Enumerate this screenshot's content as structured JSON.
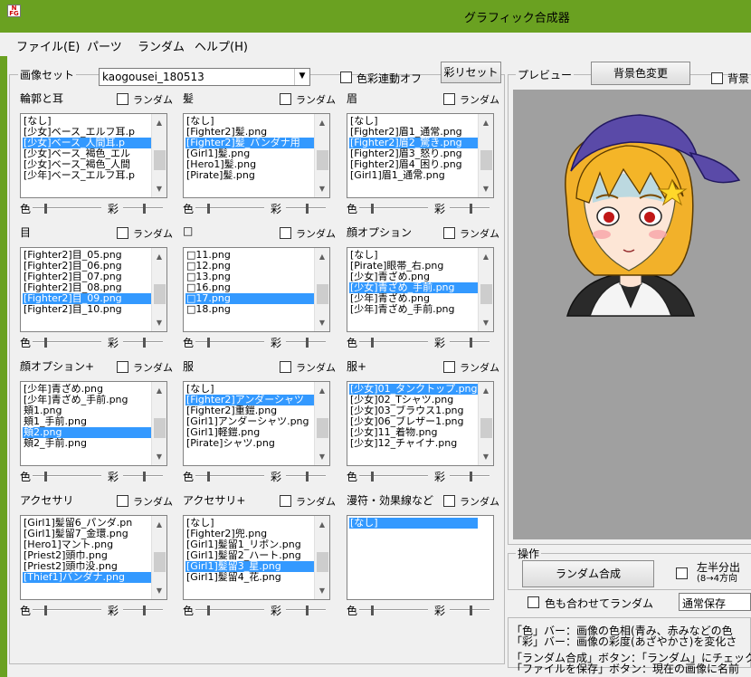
{
  "window": {
    "title": "グラフィック合成器"
  },
  "menu": [
    {
      "label": "ファイル(E)"
    },
    {
      "label": "パーツ"
    },
    {
      "label": "ランダム"
    },
    {
      "label": "ヘルプ(H)"
    }
  ],
  "image_set": {
    "label": "画像セット",
    "value": "kaogousei_180513",
    "color_link": "色彩連動オフ",
    "saturation_reset": "彩リセット"
  },
  "labels": {
    "random": "ランダム",
    "color": "色",
    "sat": "彩"
  },
  "parts": [
    {
      "title": "輪郭と耳",
      "items": [
        "[なし]",
        "[少女]ベース_エルフ耳.p",
        "[少女]ベース_人間耳.p",
        "[少女]ベース_褐色_エル",
        "[少女]ベース_褐色_人間",
        "[少年]ベース_エルフ耳.p"
      ],
      "selected": 2
    },
    {
      "title": "髪",
      "items": [
        "[なし]",
        "[Fighter2]髪.png",
        "[Fighter2]髪_バンダナ用",
        "[Girl1]髪.png",
        "[Hero1]髪.png",
        "[Pirate]髪.png"
      ],
      "selected": 2
    },
    {
      "title": "眉",
      "items": [
        "[なし]",
        "[Fighter2]眉1_通常.png",
        "[Fighter2]眉2_驚き.png",
        "[Fighter2]眉3_怒り.png",
        "[Fighter2]眉4_困り.png",
        "[Girl1]眉1_通常.png"
      ],
      "selected": 2
    },
    {
      "title": "目",
      "items": [
        "[Fighter2]目_05.png",
        "[Fighter2]目_06.png",
        "[Fighter2]目_07.png",
        "[Fighter2]目_08.png",
        "[Fighter2]目_09.png",
        "[Fighter2]目_10.png"
      ],
      "selected": 4
    },
    {
      "title": "□",
      "items": [
        "□11.png",
        "□12.png",
        "□13.png",
        "□16.png",
        "□17.png",
        "□18.png"
      ],
      "selected": 4
    },
    {
      "title": "顔オプション",
      "items": [
        "[なし]",
        "[Pirate]眼帯_右.png",
        "[少女]青ざめ.png",
        "[少女]青ざめ_手前.png",
        "[少年]青ざめ.png",
        "[少年]青ざめ_手前.png"
      ],
      "selected": 3
    },
    {
      "title": "顔オプション+",
      "items": [
        "[少年]青ざめ.png",
        "[少年]青ざめ_手前.png",
        "頬1.png",
        "頬1_手前.png",
        "頬2.png",
        "頬2_手前.png"
      ],
      "selected": 4
    },
    {
      "title": "服",
      "items": [
        "[なし]",
        "[Fighter2]アンダーシャツ",
        "[Fighter2]重鎧.png",
        "[Girl1]アンダーシャツ.png",
        "[Girl1]軽鎧.png",
        "[Pirate]シャツ.png"
      ],
      "selected": 1
    },
    {
      "title": "服+",
      "items": [
        "[少女]01_タンクトップ.png",
        "[少女]02_Tシャツ.png",
        "[少女]03_ブラウス1.png",
        "[少女]06_ブレザー1.png",
        "[少女]11_着物.png",
        "[少女]12_チャイナ.png"
      ],
      "selected": 0
    },
    {
      "title": "アクセサリ",
      "items": [
        "[Girl1]髪留6_パンダ.pn",
        "[Girl1]髪留7_金環.png",
        "[Hero1]マント.png",
        "[Priest2]頭巾.png",
        "[Priest2]頭巾没.png",
        "[Thief1]バンダナ.png"
      ],
      "selected": 5
    },
    {
      "title": "アクセサリ+",
      "items": [
        "[なし]",
        "[Fighter2]兜.png",
        "[Girl1]髪留1_リボン.png",
        "[Girl1]髪留2_ハート.png",
        "[Girl1]髪留3_星.png",
        "[Girl1]髪留4_花.png"
      ],
      "selected": 4
    },
    {
      "title": "漫符・効果線など",
      "items": [
        "[なし]"
      ],
      "selected": 0
    }
  ],
  "preview": {
    "label": "プレビュー",
    "bg_button": "背景色変更",
    "bg_check": "背景"
  },
  "operation": {
    "label": "操作",
    "random_button": "ランダム合成",
    "match_color": "色も合わせてランダム",
    "split_check_line1": "左半分出",
    "split_check_line2": "(8→4方向",
    "save_mode": "通常保存"
  },
  "description": [
    "「色」バー：画像の色相(青み、赤みなどの色",
    "「彩」バー：画像の彩度(あざやかさ)を変化さ",
    "「ランダム合成」ボタン：「ランダム」にチェックが",
    "「ファイルを保存」ボタン：現在の画像に名前"
  ],
  "colors": {
    "titlebar": "#6aa121",
    "selection": "#3399ff",
    "preview_bg": "#a0a0a0"
  }
}
